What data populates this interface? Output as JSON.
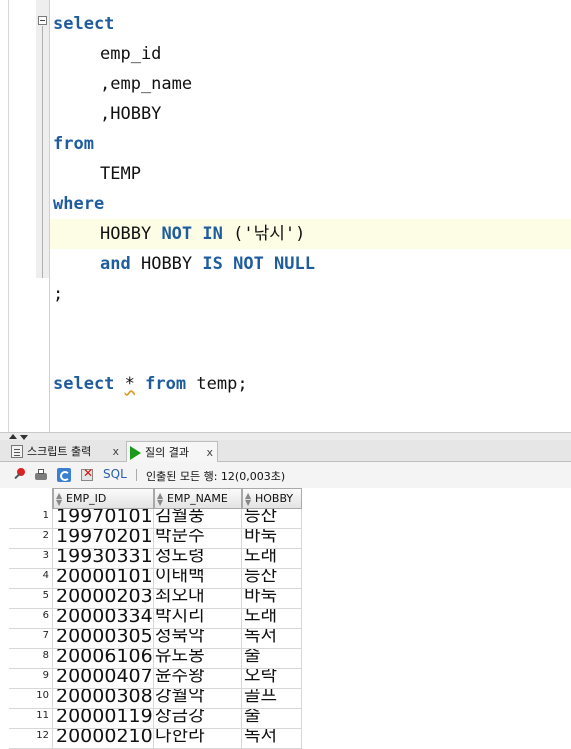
{
  "editor": {
    "lines": [
      {
        "keyword": "select"
      },
      {
        "text": "emp_id"
      },
      {
        "text": ",emp_name"
      },
      {
        "text": ",HOBBY"
      },
      {
        "keyword": "from"
      },
      {
        "text": "TEMP"
      },
      {
        "keyword": "where"
      },
      {
        "col": "HOBBY",
        "kw1": "NOT IN",
        "open": "(",
        "str": "'낚시'",
        "close": ")"
      },
      {
        "kw1": "and",
        "col": "HOBBY",
        "kw2": "IS NOT NULL"
      },
      {
        "text": ";"
      },
      {
        "kw1": "select",
        "star": "*",
        "kw2": "from",
        "rest": "temp;"
      }
    ]
  },
  "tabs": [
    {
      "label": "스크립트 출력",
      "close": "x",
      "icon": "script-icon"
    },
    {
      "label": "질의 결과",
      "close": "x",
      "icon": "play-icon"
    }
  ],
  "toolbar": {
    "icons": [
      "pin-icon",
      "print-icon",
      "refresh-icon",
      "cancel-icon"
    ],
    "sql_label": "SQL",
    "separator": "|",
    "fetch_status": "인출된 모든 행: 12(0,003초)"
  },
  "grid": {
    "columns": [
      "EMP_ID",
      "EMP_NAME",
      "HOBBY"
    ],
    "rows": [
      {
        "n": "1",
        "id": "19970101",
        "name": "김월풍",
        "hobby": "등산"
      },
      {
        "n": "2",
        "id": "19970201",
        "name": "박문수",
        "hobby": "바둑"
      },
      {
        "n": "3",
        "id": "19930331",
        "name": "정도령",
        "hobby": "노래"
      },
      {
        "n": "4",
        "id": "20000101",
        "name": "이태백",
        "hobby": "등산"
      },
      {
        "n": "5",
        "id": "20000203",
        "name": "최오대",
        "hobby": "바둑"
      },
      {
        "n": "6",
        "id": "20000334",
        "name": "박지리",
        "hobby": "노래"
      },
      {
        "n": "7",
        "id": "20000305",
        "name": "정북악",
        "hobby": "독서"
      },
      {
        "n": "8",
        "id": "20006106",
        "name": "유도봉",
        "hobby": "술"
      },
      {
        "n": "9",
        "id": "20000407",
        "name": "윤주왕",
        "hobby": "오락"
      },
      {
        "n": "10",
        "id": "20000308",
        "name": "강월악",
        "hobby": "골프"
      },
      {
        "n": "11",
        "id": "20000119",
        "name": "장금강",
        "hobby": "술"
      },
      {
        "n": "12",
        "id": "20000210",
        "name": "나한라",
        "hobby": "독서"
      }
    ]
  }
}
